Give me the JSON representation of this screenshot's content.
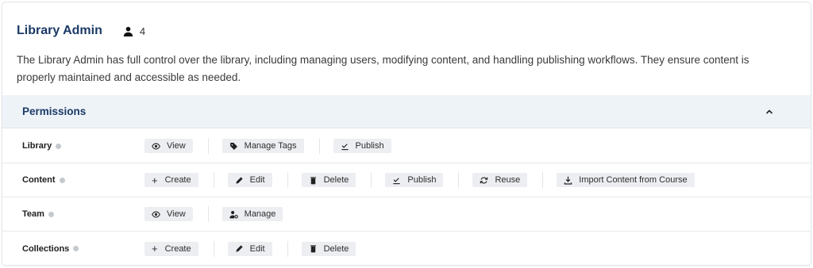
{
  "role": {
    "title": "Library Admin",
    "user_count": "4",
    "description": "The Library Admin has full control over the library, including managing users, modifying content, and handling publishing workflows. They ensure content is properly maintained and accessible as needed."
  },
  "permissions": {
    "header": "Permissions",
    "collapse_icon": "chevron-up-icon",
    "rows": [
      {
        "label": "Library",
        "actions": [
          {
            "label": "View",
            "icon": "eye-icon"
          },
          {
            "label": "Manage Tags",
            "icon": "tag-icon"
          },
          {
            "label": "Publish",
            "icon": "publish-icon"
          }
        ]
      },
      {
        "label": "Content",
        "actions": [
          {
            "label": "Create",
            "icon": "plus-icon"
          },
          {
            "label": "Edit",
            "icon": "pencil-icon"
          },
          {
            "label": "Delete",
            "icon": "trash-icon"
          },
          {
            "label": "Publish",
            "icon": "publish-icon"
          },
          {
            "label": "Reuse",
            "icon": "refresh-icon"
          },
          {
            "label": "Import Content from Course",
            "icon": "download-icon"
          }
        ]
      },
      {
        "label": "Team",
        "actions": [
          {
            "label": "View",
            "icon": "eye-icon"
          },
          {
            "label": "Manage",
            "icon": "user-gear-icon"
          }
        ]
      },
      {
        "label": "Collections",
        "actions": [
          {
            "label": "Create",
            "icon": "plus-icon"
          },
          {
            "label": "Edit",
            "icon": "pencil-icon"
          },
          {
            "label": "Delete",
            "icon": "trash-icon"
          }
        ]
      }
    ]
  }
}
